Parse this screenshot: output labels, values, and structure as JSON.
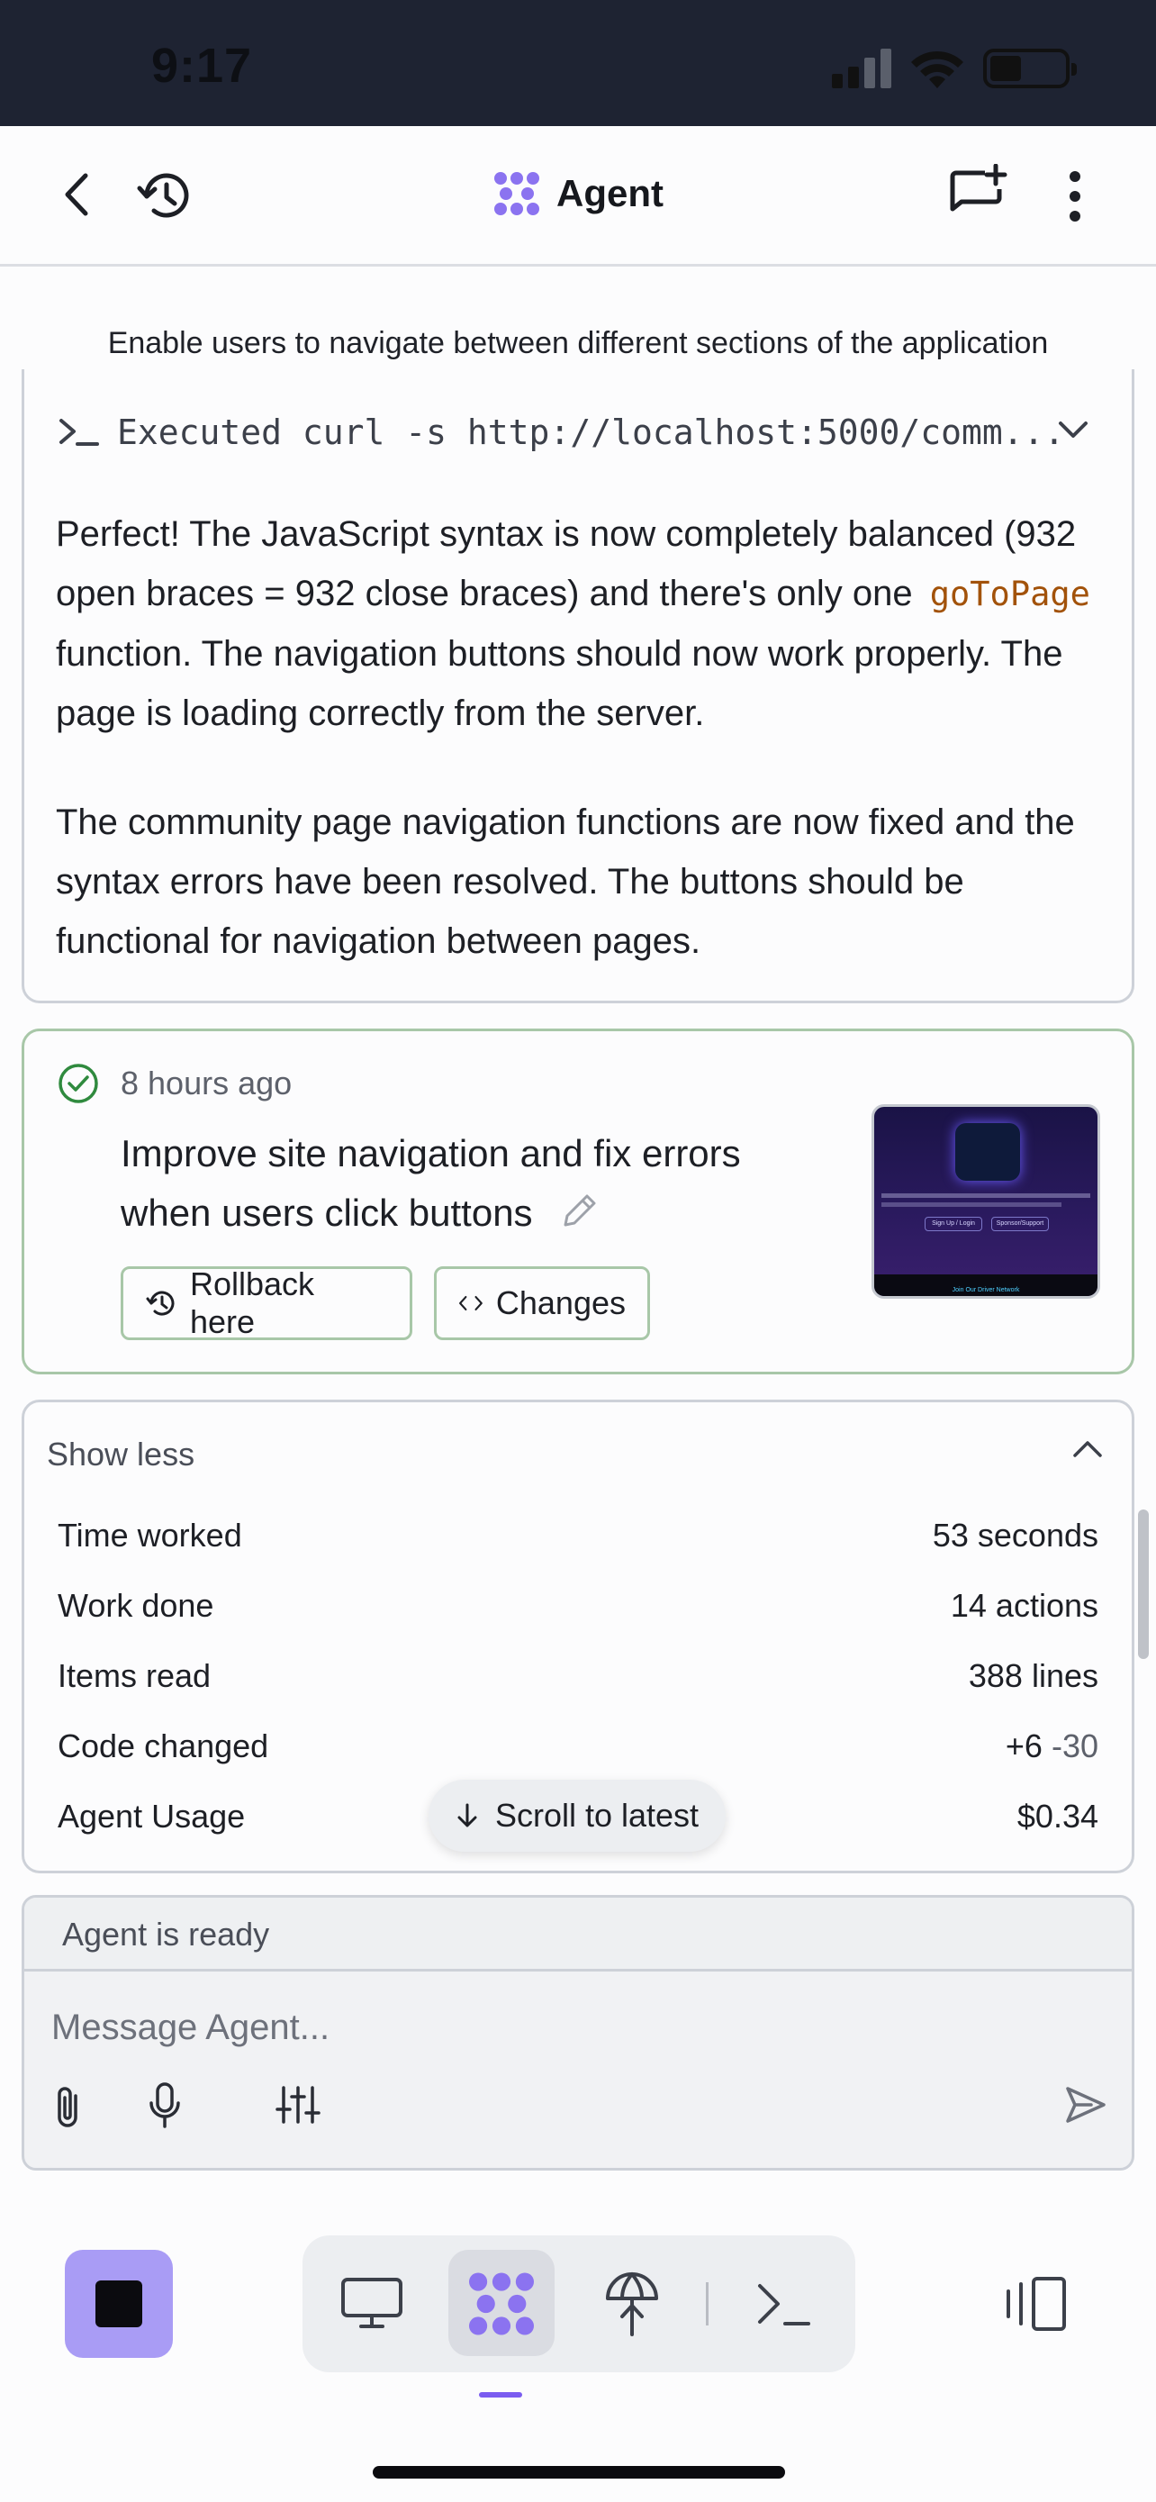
{
  "status_bar": {
    "time": "9:17"
  },
  "header": {
    "title": "Agent",
    "icons": [
      "back-icon",
      "history-icon",
      "agent-logo-icon",
      "new-chat-icon",
      "more-icon"
    ]
  },
  "context_banner": "Enable users to navigate between different sections of the application",
  "tool_call": {
    "text": "Executed curl -s http://localhost:5000/comm..."
  },
  "message": {
    "p1_before": "Perfect! The JavaScript syntax is now completely balanced (932 open braces = 932 close braces) and there's only one",
    "p1_code": "goToPage",
    "p1_after": "function. The navigation buttons should now work properly. The page is loading correctly from the server.",
    "p2": "The community page navigation functions are now fixed and the syntax errors have been resolved. The buttons should be functional for navigation between pages."
  },
  "checkpoint": {
    "time_ago": "8 hours ago",
    "title": "Improve site navigation and fix errors when users click buttons",
    "rollback_label": "Rollback here",
    "changes_label": "Changes",
    "thumbnail_button_1": "Sign Up / Login",
    "thumbnail_button_2": "Sponsor/Support",
    "thumbnail_footer": "Join Our Driver Network"
  },
  "stats": {
    "toggle_label": "Show less",
    "rows": [
      {
        "label": "Time worked",
        "value": "53 seconds"
      },
      {
        "label": "Work done",
        "value": "14 actions"
      },
      {
        "label": "Items read",
        "value": "388 lines"
      },
      {
        "label": "Code changed",
        "value_added": "+6",
        "value_removed": "-30"
      },
      {
        "label": "Agent Usage",
        "value": "$0.34"
      }
    ],
    "scroll_label": "Scroll to latest"
  },
  "composer": {
    "status": "Agent is ready",
    "placeholder": "Message Agent..."
  },
  "colors": {
    "status_bar_bg": "#1e2332",
    "accent": "#7b5cf0",
    "stop_button": "#a99cf5",
    "checkpoint_border": "#a8c7a8",
    "code_text": "#a2520a"
  }
}
